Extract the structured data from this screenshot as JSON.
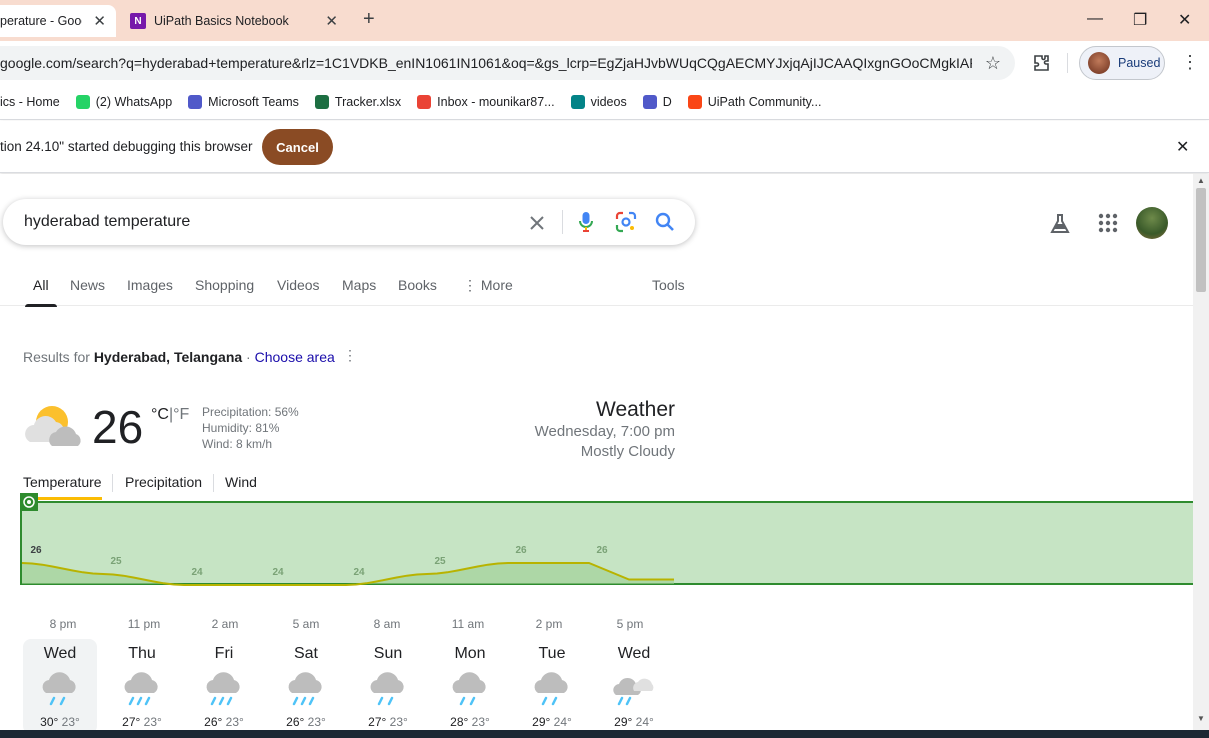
{
  "browser": {
    "tabs": [
      {
        "title": "perature - Goog",
        "active": true
      },
      {
        "title": "UiPath Basics Notebook",
        "active": false
      }
    ],
    "new_tab_glyph": "+",
    "url": "google.com/search?q=hyderabad+temperature&rlz=1C1VDKB_enIN1061IN1061&oq=&gs_lcrp=EgZjaHJvbWUqCQgAECMYJxjqAjIJCAAQIxgnGOoCMgkIAR...",
    "profile_status": "Paused",
    "bookmarks": [
      {
        "label": "ics - Home",
        "icon": "uipath-icon",
        "color": "#fa4616"
      },
      {
        "label": "(2) WhatsApp",
        "icon": "whatsapp-icon",
        "color": "#25d366"
      },
      {
        "label": "Microsoft Teams",
        "icon": "teams-icon",
        "color": "#5059c9"
      },
      {
        "label": "Tracker.xlsx",
        "icon": "excel-icon",
        "color": "#1d6f42"
      },
      {
        "label": "Inbox - mounikar87...",
        "icon": "gmail-icon",
        "color": "#ea4335"
      },
      {
        "label": "videos",
        "icon": "sharepoint-icon",
        "color": "#038387"
      },
      {
        "label": "D",
        "icon": "teams-icon",
        "color": "#5059c9"
      },
      {
        "label": "UiPath Community...",
        "icon": "uipath-icon",
        "color": "#fa4616"
      }
    ],
    "debug_message": "tion 24.10\" started debugging this browser",
    "debug_cancel": "Cancel"
  },
  "search": {
    "query": "hyderabad temperature",
    "tabs": [
      "All",
      "News",
      "Images",
      "Shopping",
      "Videos",
      "Maps",
      "Books",
      "More",
      "Tools"
    ],
    "selected_tab": "All"
  },
  "weather": {
    "results_prefix": "Results for ",
    "location": "Hyderabad, Telangana",
    "location_sep": " · ",
    "choose_area": "Choose area",
    "temperature": "26",
    "unit_c": "°C",
    "unit_sep": "|",
    "unit_f": "°F",
    "precipitation": "Precipitation: 56%",
    "humidity": "Humidity: 81%",
    "wind": "Wind: 8 km/h",
    "heading": "Weather",
    "datetime": "Wednesday, 7:00 pm",
    "condition": "Mostly Cloudy",
    "tabs": [
      "Temperature",
      "Precipitation",
      "Wind"
    ],
    "selected_tab": "Temperature",
    "hour_labels": [
      "8 pm",
      "11 pm",
      "2 am",
      "5 am",
      "8 am",
      "11 am",
      "2 pm",
      "5 pm"
    ],
    "days": [
      {
        "name": "Wed",
        "hi": "30°",
        "lo": "23°",
        "icon": "rain-icon"
      },
      {
        "name": "Thu",
        "hi": "27°",
        "lo": "23°",
        "icon": "heavy-rain-icon"
      },
      {
        "name": "Fri",
        "hi": "26°",
        "lo": "23°",
        "icon": "heavy-rain-icon"
      },
      {
        "name": "Sat",
        "hi": "26°",
        "lo": "23°",
        "icon": "heavy-rain-icon"
      },
      {
        "name": "Sun",
        "hi": "27°",
        "lo": "23°",
        "icon": "rain-icon"
      },
      {
        "name": "Mon",
        "hi": "28°",
        "lo": "23°",
        "icon": "rain-icon"
      },
      {
        "name": "Tue",
        "hi": "29°",
        "lo": "24°",
        "icon": "rain-icon"
      },
      {
        "name": "Wed",
        "hi": "29°",
        "lo": "24°",
        "icon": "scattered-showers-icon"
      }
    ]
  },
  "chart_data": {
    "type": "area",
    "x": [
      "8 pm",
      "11 pm",
      "2 am",
      "5 am",
      "8 am",
      "11 am",
      "2 pm",
      "5 pm"
    ],
    "series": [
      {
        "values": [
          26,
          25,
          24,
          24,
          24,
          25,
          26,
          26
        ]
      }
    ],
    "data_labels": [
      "26",
      "25",
      "24",
      "24",
      "24",
      "25",
      "26",
      "26"
    ],
    "line_color": "#b8b300",
    "fill_color": "#b3dbb0",
    "selection_border": "#2e8b2e"
  }
}
